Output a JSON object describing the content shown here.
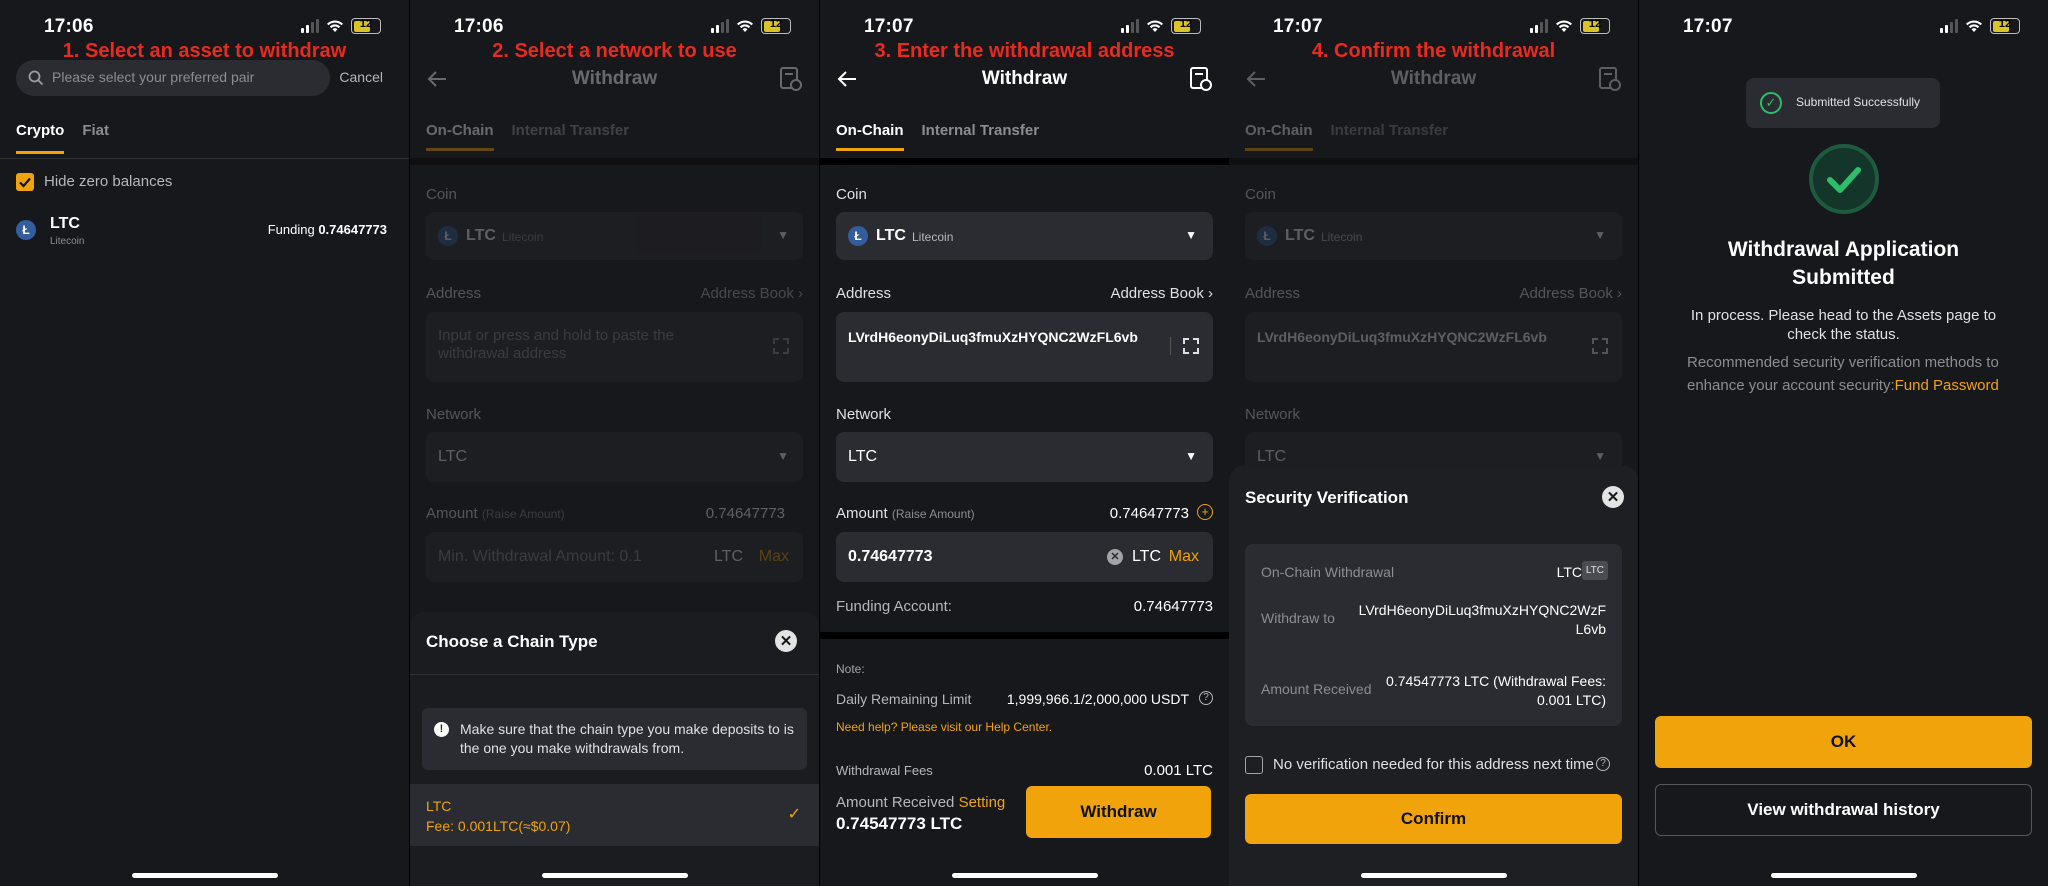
{
  "status": {
    "time1": "17:06",
    "time2": "17:06",
    "time3": "17:07",
    "time4": "17:07",
    "time5": "17:07",
    "battery": "12"
  },
  "steps": {
    "s1": "1. Select an asset to withdraw",
    "s2": "2. Select a network to use",
    "s3": "3. Enter the withdrawal address",
    "s4": "4. Confirm the withdrawal"
  },
  "panel1": {
    "search_placeholder": "Please select your preferred pair",
    "cancel": "Cancel",
    "tab_crypto": "Crypto",
    "tab_fiat": "Fiat",
    "hide_zero": "Hide zero balances",
    "asset": {
      "symbol": "LTC",
      "name": "Litecoin",
      "funding_label": "Funding",
      "funding_value": "0.74647773"
    }
  },
  "withdraw": {
    "title": "Withdraw",
    "tab_onchain": "On-Chain",
    "tab_internal": "Internal Transfer",
    "coin_label": "Coin",
    "coin_symbol": "LTC",
    "coin_name": "Litecoin",
    "address_label": "Address",
    "address_book": "Address Book",
    "address_placeholder": "Input or press and hold to paste the withdrawal address",
    "address_value": "LVrdH6eonyDiLuq3fmuXzHYQNC2WzFL6vb",
    "network_label": "Network",
    "network_value": "LTC",
    "amount_label": "Amount",
    "raise_amount": "(Raise Amount)",
    "amount_avail": "0.74647773",
    "amount_placeholder": "Min. Withdrawal Amount: 0.1",
    "amount_value": "0.74647773",
    "unit": "LTC",
    "max": "Max",
    "funding_account_label": "Funding Account:",
    "funding_account_value": "0.74647773",
    "note": "Note:",
    "daily_limit_label": "Daily Remaining Limit",
    "daily_limit_value": "1,999,966.1/2,000,000 USDT",
    "help": "Need help? Please visit our Help Center.",
    "fees_label": "Withdrawal Fees",
    "fees_value": "0.001 LTC",
    "received_label": "Amount Received",
    "setting": "Setting",
    "received_value": "0.74547773 LTC",
    "withdraw_button": "Withdraw"
  },
  "chain_sheet": {
    "title": "Choose a Chain Type",
    "warning": "Make sure that the chain type you make deposits to is the one you make withdrawals from.",
    "option_name": "LTC",
    "option_fee": "Fee: 0.001LTC(≈$0.07)"
  },
  "security": {
    "title": "Security Verification",
    "row1_label": "On-Chain Withdrawal",
    "row1_value": "LTC",
    "row1_badge": "LTC",
    "row2_label": "Withdraw to",
    "row2_value": "LVrdH6eonyDiLuq3fmuXzHYQNC2WzFL6vb",
    "row3_label": "Amount Received",
    "row3_value": "0.74547773 LTC (Withdrawal Fees: 0.001 LTC)",
    "no_verify": "No verification needed for this address next time",
    "confirm": "Confirm"
  },
  "success": {
    "toast": "Submitted Successfully",
    "title": "Withdrawal Application Submitted",
    "desc": "In process. Please head to the Assets page to check the status.",
    "recommend": "Recommended security verification methods to enhance your account security:",
    "fund_password": "Fund Password",
    "ok": "OK",
    "history": "View withdrawal history"
  },
  "colors": {
    "accent": "#f0a30a",
    "step_red": "#e82a20",
    "ltc_blue": "#345d9d",
    "success_green": "#2ebd6b"
  }
}
